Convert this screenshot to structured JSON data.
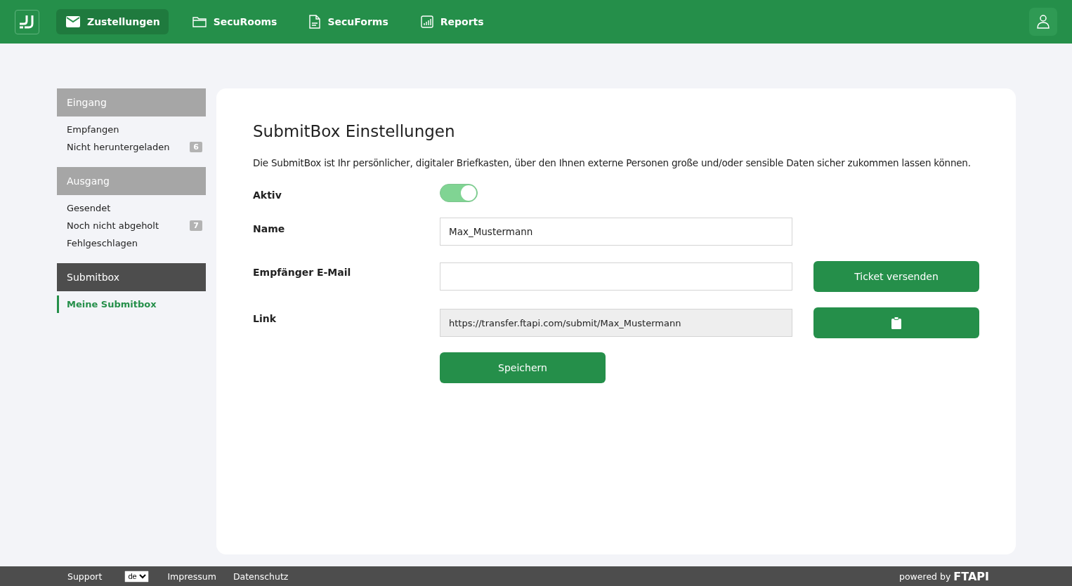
{
  "nav": {
    "tabs": [
      {
        "label": "Zustellungen",
        "kind": "mail",
        "selected": true
      },
      {
        "label": "SecuRooms",
        "kind": "folder",
        "selected": false
      },
      {
        "label": "SecuForms",
        "kind": "doc",
        "selected": false
      },
      {
        "label": "Reports",
        "kind": "chart",
        "selected": false
      }
    ]
  },
  "sidebar": {
    "groups": [
      {
        "title": "Eingang",
        "selected": false,
        "items": [
          {
            "label": "Empfangen",
            "selected": false
          },
          {
            "label": "Nicht heruntergeladen",
            "badge": "6",
            "selected": false
          }
        ]
      },
      {
        "title": "Ausgang",
        "selected": false,
        "items": [
          {
            "label": "Gesendet",
            "selected": false
          },
          {
            "label": "Noch nicht abgeholt",
            "badge": "7",
            "selected": false
          },
          {
            "label": "Fehlgeschlagen",
            "selected": false
          }
        ]
      },
      {
        "title": "Submitbox",
        "selected": true,
        "items": [
          {
            "label": "Meine Submitbox",
            "selected": true
          }
        ]
      }
    ]
  },
  "content": {
    "title": "SubmitBox Einstellungen",
    "description": "Die SubmitBox ist Ihr persönlicher, digitaler Briefkasten, über den Ihnen externe Personen große und/oder sensible Daten sicher zukommen lassen können.",
    "fields": [
      {
        "kind": "toggle",
        "label": "Aktiv",
        "on": true
      },
      {
        "kind": "text",
        "label": "Name",
        "value": "Max_Mustermann"
      },
      {
        "kind": "text",
        "label": "Empfänger E-Mail",
        "button": "Ticket versenden"
      },
      {
        "kind": "readonly",
        "label": "Link",
        "value": "https://transfer.ftapi.com/submit/Max_Mustermann"
      }
    ],
    "save_button": "Speichern"
  },
  "footer": {
    "links": [
      "Support",
      "Impressum",
      "Datenschutz"
    ],
    "language": "de",
    "powered_by": "powered by",
    "brand": "FTAPI"
  }
}
